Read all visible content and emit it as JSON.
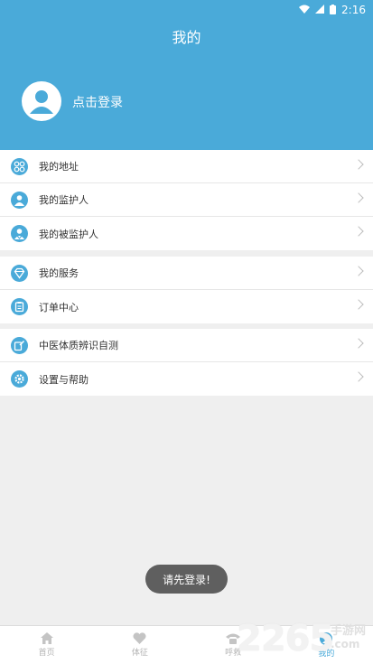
{
  "status_bar": {
    "time": "2:16",
    "icons": [
      "wifi-icon",
      "signal-icon",
      "battery-icon"
    ]
  },
  "header": {
    "title": "我的",
    "login_text": "点击登录"
  },
  "groups": [
    {
      "items": [
        {
          "label": "我的地址",
          "icon": "address-icon"
        },
        {
          "label": "我的监护人",
          "icon": "guardian-icon"
        },
        {
          "label": "我的被监护人",
          "icon": "ward-icon"
        }
      ]
    },
    {
      "items": [
        {
          "label": "我的服务",
          "icon": "service-icon"
        },
        {
          "label": "订单中心",
          "icon": "order-icon"
        }
      ]
    },
    {
      "items": [
        {
          "label": "中医体质辨识自测",
          "icon": "tcm-test-icon"
        },
        {
          "label": "设置与帮助",
          "icon": "settings-icon"
        }
      ]
    }
  ],
  "toast": "请先登录!",
  "tabbar": {
    "tabs": [
      {
        "label": "首页",
        "icon": "home-icon"
      },
      {
        "label": "体征",
        "icon": "heart-icon"
      },
      {
        "label": "呼救",
        "icon": "phone-icon"
      },
      {
        "label": "我的",
        "icon": "user-icon",
        "active": true
      }
    ]
  },
  "watermark": {
    "number": "2265",
    "cn": "手游网",
    "domain": ".com"
  },
  "colors": {
    "accent": "#4aaad9",
    "background": "#efefef"
  }
}
